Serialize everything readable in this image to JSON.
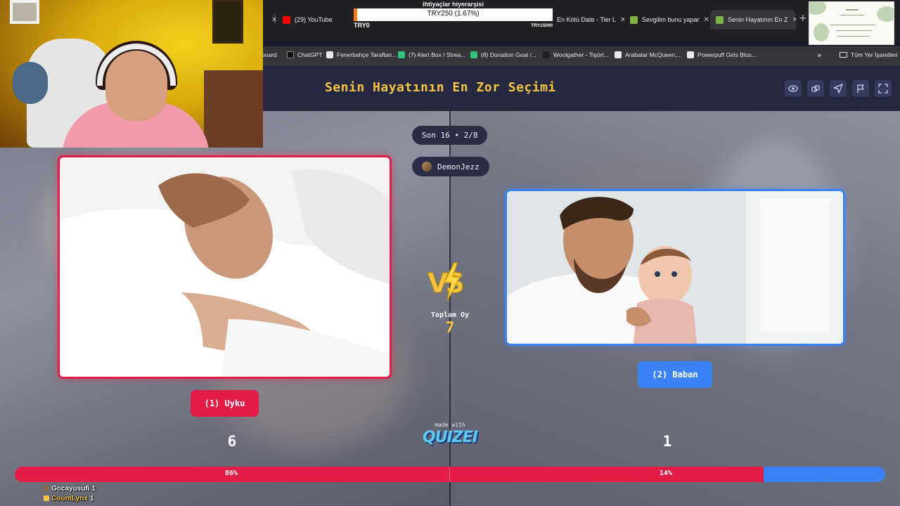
{
  "browser": {
    "tabs": [
      {
        "label": "(29) YouTube",
        "color": "#ff0000"
      },
      {
        "label": "En Kötü Date - Tier L",
        "color": "#9aa0a6"
      },
      {
        "label": "Sevgilim bunu yapar",
        "color": "#7cb342"
      },
      {
        "label": "Senin Hayatının En Z",
        "color": "#7cb342",
        "active": true
      }
    ],
    "bookmarks": [
      "board",
      "ChatGPT",
      "Fenerbahçe Taraftan...",
      "(7) Alert Box / Strea...",
      "(8) Donation Goal /...",
      "Woolgather - Tişört...",
      "Arabalar McQueen,...",
      "Powerpuff Girls Blos..."
    ],
    "bookmarks_folder": "Tüm Yer İşaretleri"
  },
  "donation_goal": {
    "title": "ihtiyaçlar hiyerarşisi",
    "current": "TRY250 (1.67%)",
    "progress": 0.0167,
    "min": "TRY0",
    "max": "TRY15000"
  },
  "quiz": {
    "title": "Senin Hayatının En Zor Seçimi",
    "round": "Son 16 • 2/8",
    "streamer": "DemonJezz",
    "total_label": "Toplam Oy",
    "total_votes": "7",
    "vs_label": "VS",
    "options": {
      "left": {
        "label": "(1) Uyku",
        "votes": "6",
        "percent": "86%",
        "share": 0.86,
        "color": "#e11d48"
      },
      "right": {
        "label": "(2) Baban",
        "votes": "1",
        "percent": "14%",
        "share": 0.14,
        "color": "#3b82f6"
      }
    },
    "made_with": "made with",
    "brand": "QUIZEI"
  },
  "voters": [
    {
      "name": "Gocayusufi",
      "count": "1",
      "color": "#ffffff"
    },
    {
      "name": "CountLynx",
      "count": "1",
      "color": "#f5c542"
    }
  ]
}
